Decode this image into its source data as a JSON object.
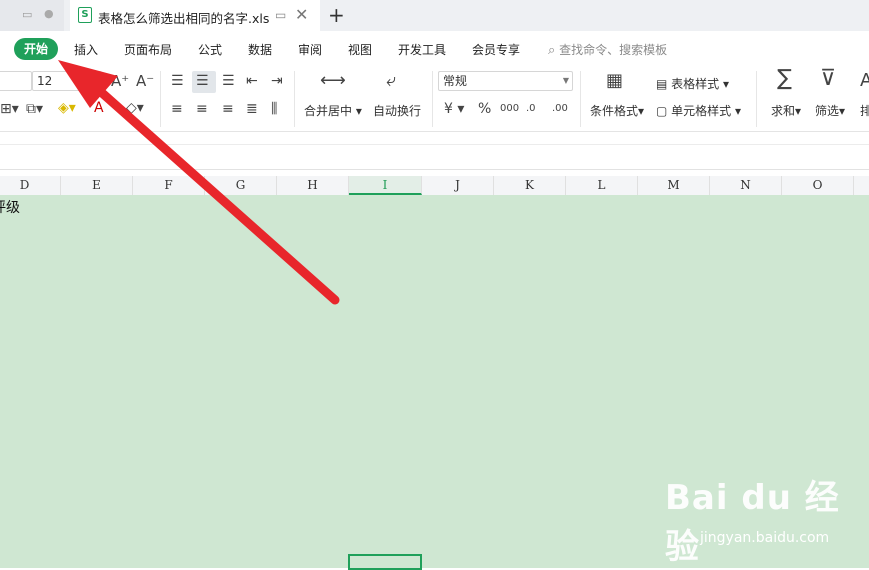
{
  "tabs": {
    "active_title": "表格怎么筛选出相同的名字.xls",
    "file_icon_letter": "S"
  },
  "menu": {
    "active": "开始",
    "items": [
      "插入",
      "页面布局",
      "公式",
      "数据",
      "审阅",
      "视图",
      "开发工具",
      "会员专享"
    ],
    "search_placeholder": "查找命令、搜索模板"
  },
  "ribbon": {
    "font_size": "12",
    "number_format": "常规",
    "merge_center": "合并居中",
    "wrap_text": "自动换行",
    "conditional_format": "条件格式",
    "table_style": "表格样式",
    "cell_style": "单元格样式",
    "sum": "求和",
    "filter": "筛选",
    "sort_partial": "排"
  },
  "columns": [
    "D",
    "E",
    "F",
    "G",
    "H",
    "I",
    "J",
    "K",
    "L",
    "M",
    "N",
    "O"
  ],
  "selected_column": "I",
  "cell_text": "评级",
  "watermark": {
    "logo": "Bai du 经验",
    "url": "jingyan.baidu.com"
  },
  "colors": {
    "accent": "#1fa05a",
    "grid_bg": "#cfe7d2",
    "arrow": "#e8262b"
  }
}
